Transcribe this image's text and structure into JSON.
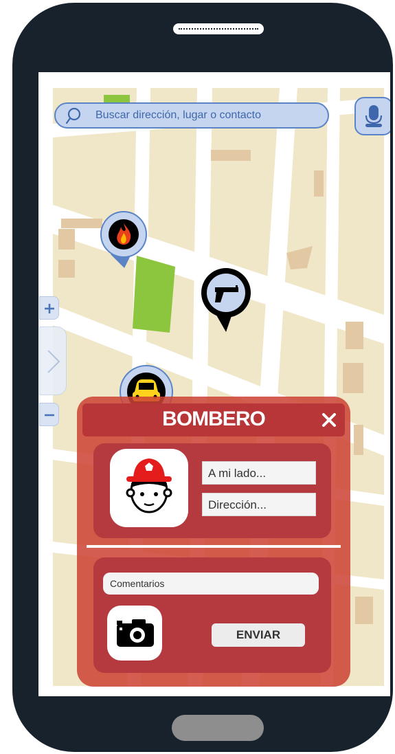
{
  "search": {
    "placeholder": "Buscar dirección, lugar o contacto"
  },
  "map": {
    "zoom_in_symbol": "+",
    "zoom_out_symbol": "−",
    "markers": [
      {
        "name": "fire-incident",
        "icon": "fire-icon"
      },
      {
        "name": "armed-incident",
        "icon": "gun-icon"
      },
      {
        "name": "vehicle-incident",
        "icon": "car-icon"
      }
    ]
  },
  "dialog": {
    "title": "BOMBERO",
    "close_symbol": "✕",
    "avatar_icon": "firefighter-icon",
    "nearby_placeholder": "A mi lado...",
    "address_placeholder": "Dirección...",
    "comments_placeholder": "Comentarios",
    "camera_icon": "camera-icon",
    "send_label": "ENVIAR"
  },
  "colors": {
    "phone_body": "#18222d",
    "map_block": "#f0e6c8",
    "map_road": "#ffffff",
    "park": "#8cc63f",
    "search_fill": "#c5d5ef",
    "search_border": "#5b84c6",
    "dialog": "#cd4234",
    "dialog_header": "#b83538"
  }
}
